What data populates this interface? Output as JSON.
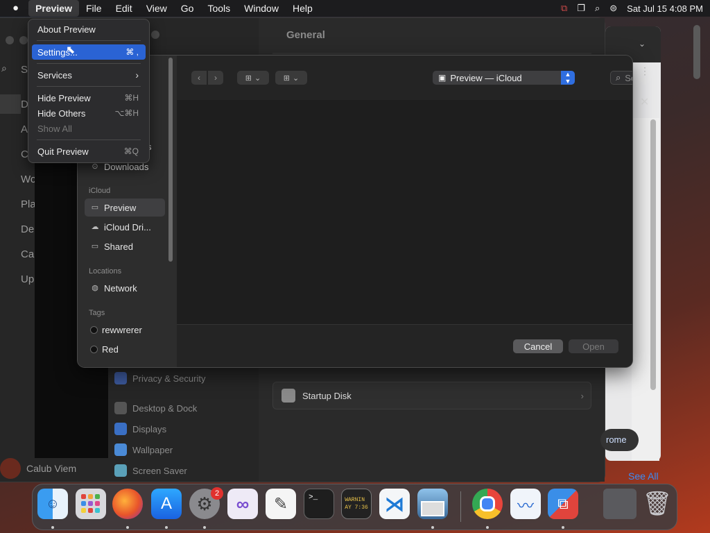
{
  "menubar": {
    "app": "Preview",
    "items": [
      "File",
      "Edit",
      "View",
      "Go",
      "Tools",
      "Window",
      "Help"
    ],
    "datetime": "Sat Jul 15  4:08 PM"
  },
  "app_menu": {
    "about": "About Preview",
    "settings": "Settings...",
    "settings_sc": "⌘ ,",
    "services": "Services",
    "services_arrow": "›",
    "hide": "Hide Preview",
    "hide_sc": "⌘H",
    "hide_others": "Hide Others",
    "hide_others_sc": "⌥⌘H",
    "show_all": "Show All",
    "quit": "Quit Preview",
    "quit_sc": "⌘Q"
  },
  "settings_window": {
    "title": "General",
    "side_fragments": [
      "S",
      "D",
      "A",
      "C",
      "Wo",
      "Pla",
      "De",
      "Ca",
      "Up"
    ],
    "rows": [
      "Privacy & Security",
      "Desktop & Dock",
      "Displays",
      "Wallpaper",
      "Screen Saver"
    ],
    "startup_disk": "Startup Disk",
    "user_name": "Calub Viem"
  },
  "dialog": {
    "location": "Preview — iCloud",
    "search_placeholder": "Search",
    "cancel": "Cancel",
    "open": "Open",
    "sidebar": {
      "partial_item": "s",
      "downloads": "Downloads",
      "icloud_header": "iCloud",
      "icloud_items": [
        "Preview",
        "iCloud Dri...",
        "Shared"
      ],
      "locations_header": "Locations",
      "network": "Network",
      "tags_header": "Tags",
      "tags": [
        "rewwrerer",
        "Red"
      ]
    }
  },
  "right_window": {
    "chrome_btn": "rome",
    "see_all": "See All"
  },
  "dock": {
    "badge": "2",
    "terminal_prompt": ">_",
    "console_text": "WARNIN\nAY 7:36"
  }
}
